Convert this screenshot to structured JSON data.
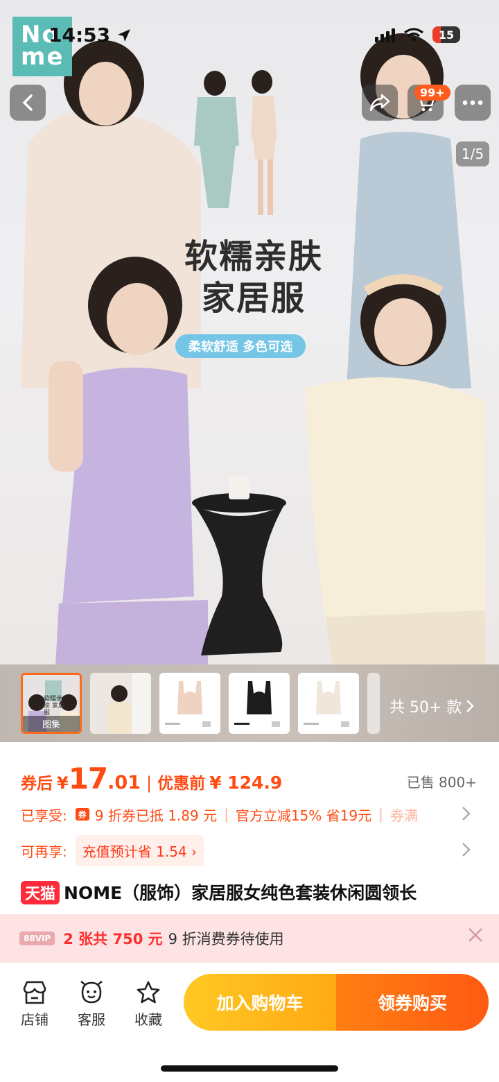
{
  "status_bar": {
    "time": "14:53",
    "battery": "15"
  },
  "brand": {
    "logo_text_top": "No",
    "logo_text_bottom": "me"
  },
  "header": {
    "cart_badge": "99+",
    "image_counter": "1/5"
  },
  "hero": {
    "headline_line1": "软糯亲肤",
    "headline_line2": "家居服",
    "subhead": "柔软舒适 多色可选"
  },
  "thumbnails": {
    "first_label": "图集",
    "more_styles": "共 50+ 款",
    "mini_headline": "软糯亲肤 家居服"
  },
  "price": {
    "after_label": "券后",
    "yen": "¥",
    "after_int": "17",
    "after_dec": ".01",
    "separator": "|",
    "before_label": "优惠前",
    "before_price": "¥ 124.9",
    "sold": "已售 800+"
  },
  "discounts": {
    "label": "已享受:",
    "coupon_icon": "券",
    "item1": "9 折券已抵 1.89 元",
    "item2": "官方立减15% 省19元",
    "item3": "券满"
  },
  "recharge": {
    "label": "可再享:",
    "chip": "充值预计省 1.54 ›"
  },
  "product": {
    "tag": "天猫",
    "title": "NOME（服饰）家居服女纯色套装休闲圆领长"
  },
  "vip": {
    "tag": "88VIP",
    "count": "2 张共 750 元",
    "desc": "9 折消费券待使用"
  },
  "bottom": {
    "store": "店铺",
    "service": "客服",
    "favorite": "收藏",
    "add_cart": "加入购物车",
    "buy": "领券购买"
  },
  "colors": {
    "accent": "#ff4a12",
    "tmall": "#ff2a3a",
    "cart_btn": "#ffb81c",
    "buy_btn": "#ff6a12"
  }
}
